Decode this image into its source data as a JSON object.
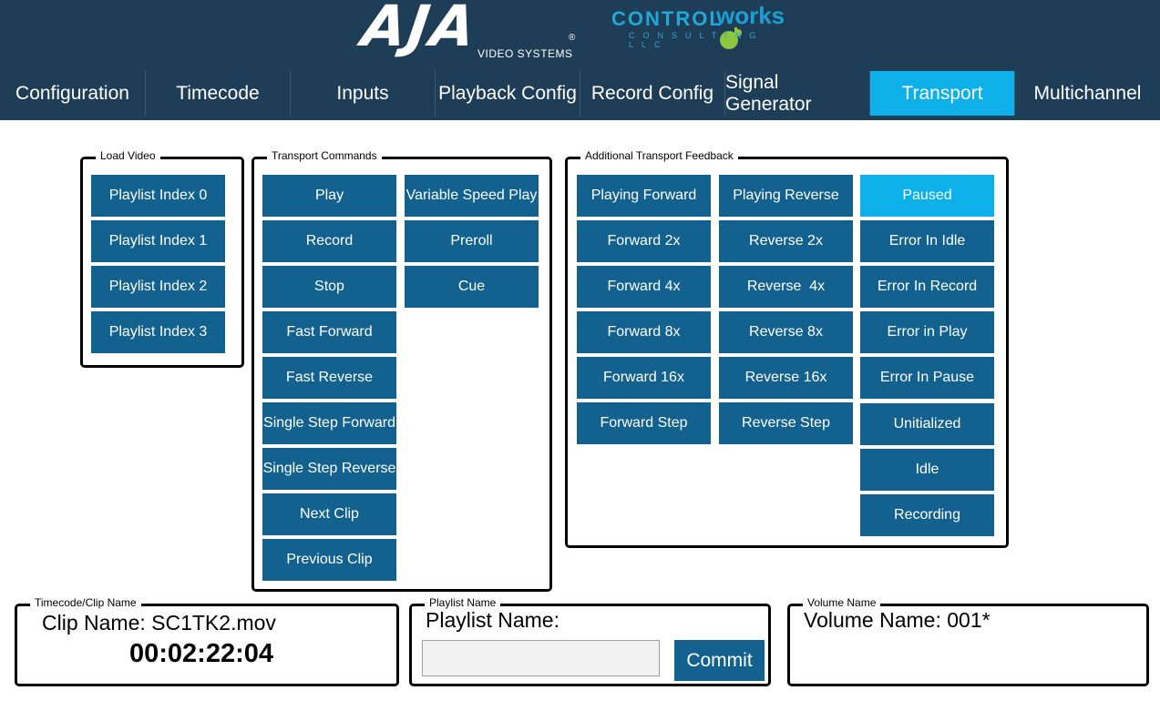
{
  "header": {
    "aja_logo": {
      "letters": "AJA",
      "sub": "VIDEO SYSTEMS",
      "reg": "®"
    },
    "cw_logo": {
      "control": "CONTROL",
      "works": "works",
      "consulting": "CONSULTING LLC"
    },
    "colors": {
      "bar": "#1e3d56",
      "accent": "#0eb0ea",
      "button": "#13618f"
    }
  },
  "tabs": [
    {
      "label": "Configuration"
    },
    {
      "label": "Timecode"
    },
    {
      "label": "Inputs"
    },
    {
      "label": "Playback Config"
    },
    {
      "label": "Record Config"
    },
    {
      "label": "Signal Generator"
    },
    {
      "label": "Transport",
      "active": true
    },
    {
      "label": "Multichannel"
    }
  ],
  "load_video": {
    "legend": "Load Video",
    "buttons": [
      "Playlist Index 0",
      "Playlist Index 1",
      "Playlist Index 2",
      "Playlist Index 3"
    ]
  },
  "transport": {
    "legend": "Transport Commands",
    "col1": [
      "Play",
      "Record",
      "Stop",
      "Fast Forward",
      "Fast Reverse",
      "Single Step Forward",
      "Single Step Reverse",
      "Next Clip",
      "Previous Clip"
    ],
    "col2": [
      "Variable Speed Play",
      "Preroll",
      "Cue"
    ]
  },
  "feedback": {
    "legend": "Additional Transport Feedback",
    "col1": [
      "Playing Forward",
      "Forward 2x",
      "Forward 4x",
      "Forward 8x",
      "Forward 16x",
      "Forward Step"
    ],
    "col2": [
      "Playing Reverse",
      "Reverse 2x",
      "Reverse  4x",
      "Reverse 8x",
      "Reverse 16x",
      "Reverse Step"
    ],
    "col3": [
      "Paused",
      "Error In Idle",
      "Error In Record",
      "Error in Play",
      "Error In Pause",
      "Unitialized",
      "Idle",
      "Recording"
    ],
    "active": "Paused"
  },
  "timecode_box": {
    "legend": "Timecode/Clip Name",
    "clip_name": "Clip Name: SC1TK2.mov",
    "timecode": "00:02:22:04"
  },
  "playlist_box": {
    "legend": "Playlist Name",
    "label": "Playlist Name:",
    "input_value": "",
    "commit_label": "Commit"
  },
  "volume_box": {
    "legend": "Volume Name",
    "label": "Volume Name: 001*"
  }
}
